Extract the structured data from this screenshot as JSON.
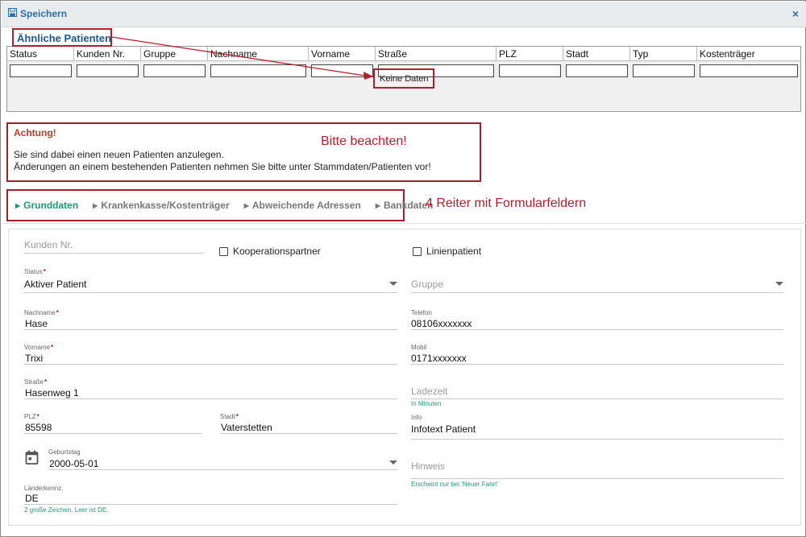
{
  "toolbar": {
    "save_label": "Speichern",
    "close_label": "×"
  },
  "similar": {
    "title": "Ähnliche Patienten",
    "columns": [
      "Status",
      "Kunden Nr.",
      "Gruppe",
      "Nachname",
      "Vorname",
      "Straße",
      "PLZ",
      "Stadt",
      "Typ",
      "Kostenträger"
    ],
    "no_data": "Keine Daten"
  },
  "warning": {
    "title": "Achtung!",
    "line1": "Sie sind dabei einen neuen Patienten anzulegen.",
    "line2": "Änderungen an einem bestehenden Patienten nehmen Sie bitte unter Stammdaten/Patienten vor!",
    "callout": "Bitte beachten!"
  },
  "tabs": {
    "items": [
      "Grunddaten",
      "Krankenkasse/Kostenträger",
      "Abweichende Adressen",
      "Bankdaten"
    ],
    "active": "Grunddaten",
    "callout": "4 Reiter mit Formularfeldern"
  },
  "form": {
    "kunden_nr": {
      "placeholder": "Kunden Nr."
    },
    "kooperationspartner": {
      "label": "Kooperationspartner",
      "checked": false
    },
    "linienpatient": {
      "label": "Linienpatient",
      "checked": false
    },
    "status": {
      "label": "Status",
      "value": "Aktiver Patient"
    },
    "gruppe": {
      "placeholder": "Gruppe"
    },
    "nachname": {
      "label": "Nachname",
      "value": "Hase"
    },
    "telefon": {
      "label": "Telefon",
      "value": "08106xxxxxxx"
    },
    "vorname": {
      "label": "Vorname",
      "value": "Trixi"
    },
    "mobil": {
      "label": "Mobil",
      "value": "0171xxxxxxx"
    },
    "strasse": {
      "label": "Straße",
      "value": "Hasenweg 1"
    },
    "ladezeit": {
      "placeholder": "Ladezeit",
      "hint": "In Minuten"
    },
    "plz": {
      "label": "PLZ",
      "value": "85598"
    },
    "stadt": {
      "label": "Stadt",
      "value": "Vaterstetten"
    },
    "info": {
      "label": "Info",
      "value": "Infotext Patient"
    },
    "geburtstag": {
      "label": "Geburtstag",
      "value": "2000-05-01"
    },
    "hinweis": {
      "placeholder": "Hinweis",
      "hint": "Erscheint nur bei 'Neuer Fahrt'"
    },
    "laenderkennz": {
      "label": "Länderkennz.",
      "value": "DE",
      "hint": "2 große Zeichen. Leer ist DE."
    }
  },
  "colors": {
    "accent_red": "#b0202a",
    "link_blue": "#2a6ea8",
    "active_green": "#1e9a78"
  }
}
